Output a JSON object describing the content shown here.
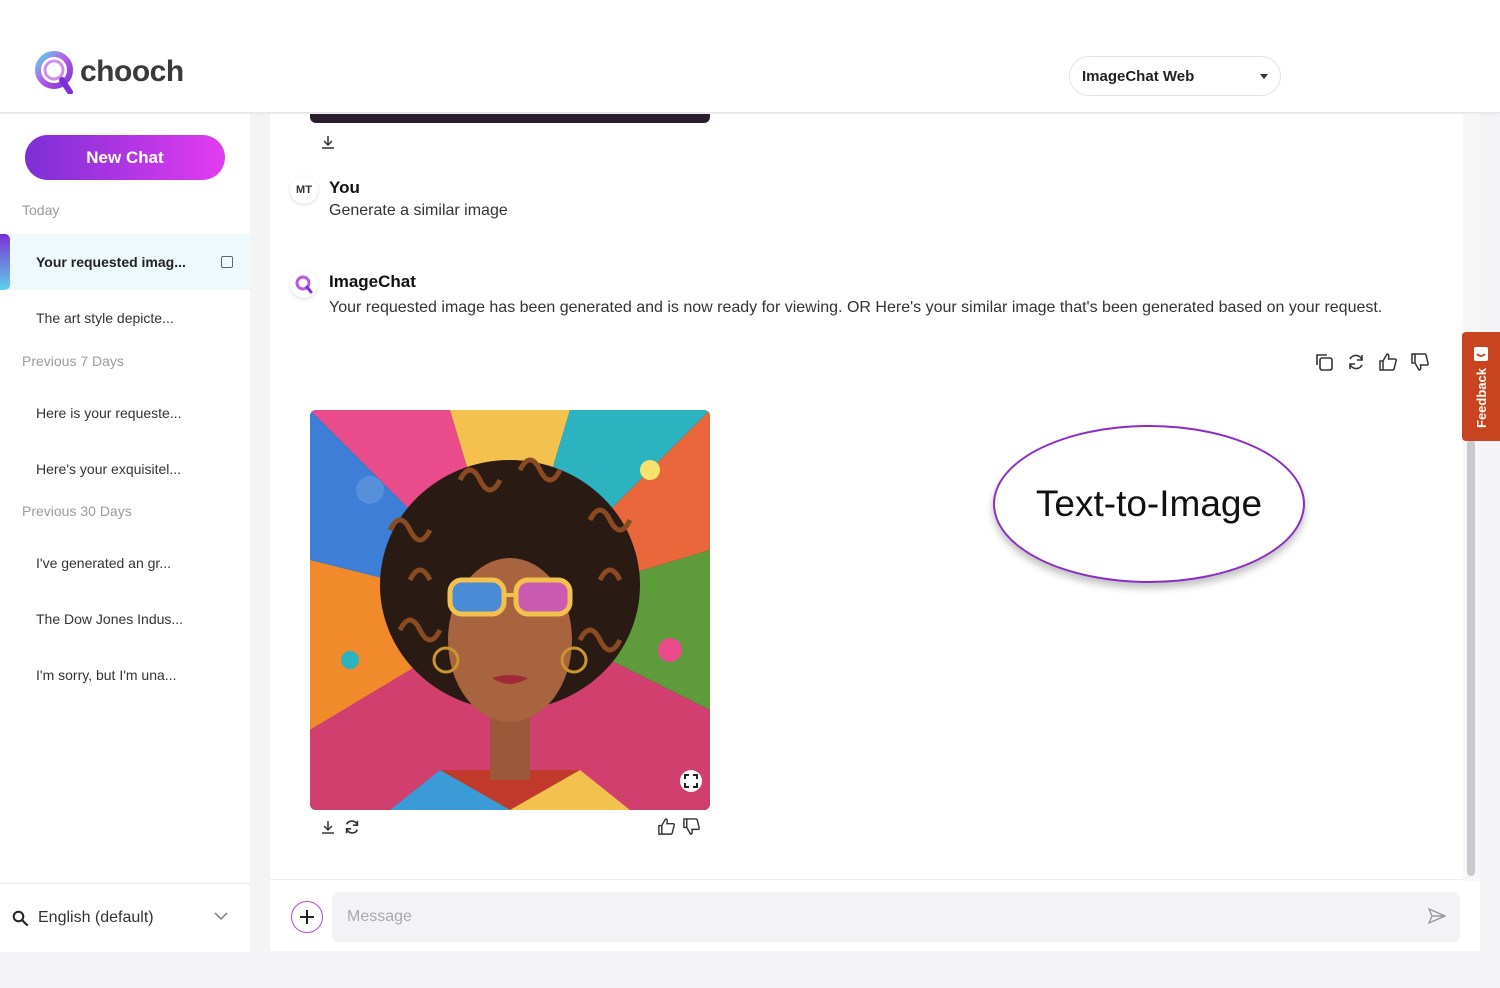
{
  "app": {
    "brand": "chooch",
    "model_select": "ImageChat Web"
  },
  "sidebar": {
    "new_chat": "New Chat",
    "sections": {
      "today": "Today",
      "prev7": "Previous 7 Days",
      "prev30": "Previous 30 Days"
    },
    "items": [
      {
        "label": "Your requested imag..."
      },
      {
        "label": "The art style depicte..."
      },
      {
        "label": "Here is your requeste..."
      },
      {
        "label": "Here's your exquisitel..."
      },
      {
        "label": "I've generated an gr..."
      },
      {
        "label": "The Dow Jones Indus..."
      },
      {
        "label": "I'm sorry, but I'm una..."
      }
    ],
    "language": "English (default)"
  },
  "chat": {
    "user": {
      "initials": "MT",
      "name": "You",
      "text": "Generate a similar image"
    },
    "bot": {
      "name": "ImageChat",
      "text": "Your requested image has been generated and is now ready for viewing. OR Here's your similar image that's been generated based on your request."
    },
    "callout": "Text-to-Image",
    "composer_placeholder": "Message"
  },
  "feedback": "Feedback",
  "colors": {
    "accent_start": "#7c2fd6",
    "accent_end": "#e23cf0",
    "feedback": "#c8441f"
  }
}
